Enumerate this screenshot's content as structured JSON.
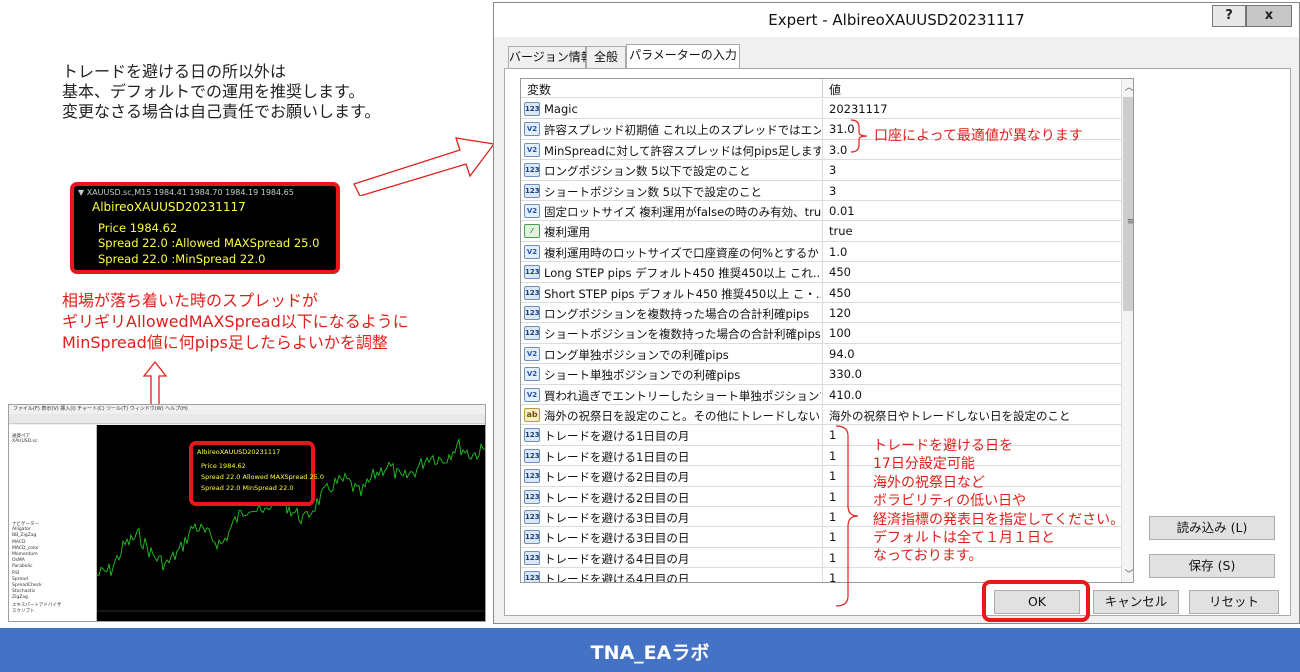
{
  "left_note": {
    "line1": "トレードを避ける日の所以外は",
    "line2": "基本、デフォルトでの運用を推奨します。",
    "line3": "変更なさる場合は自己責任でお願いします。"
  },
  "chart_info": {
    "header": "▼ XAUUSD.sc,M15  1984.41 1984.70 1984.19 1984.65",
    "name": "AlbireoXAUUSD20231117",
    "price": "Price  1984.62",
    "spread_allowed": "Spread  22.0  :Allowed MAXSpread  25.0",
    "spread_min": "Spread  22.0  :MinSpread  22.0"
  },
  "red_note": {
    "line1": "相場が落ち着いた時のスプレッドが",
    "line2": "ギリギリAllowedMAXSpread以下になるように",
    "line3": "MinSpread値に何pips足したらよいかを調整"
  },
  "mini_mt4": {
    "menu": "ファイル(F)  表示(V)  挿入(I)  チャート(C)  ツール(T)  ウィンドウ(W)  ヘルプ(H)",
    "left_items": [
      "通貨ペア",
      "XAUUSD.sc",
      "",
      "",
      "",
      "",
      "",
      "ナビゲーター",
      "Alligator",
      "BB_ZigZag",
      "MACD",
      "MACD_color",
      "Momentum",
      "OsMA",
      "Parabolic",
      "RSI",
      "Spread",
      "SpreadCheck",
      "Stochastic",
      "ZigZag",
      "エキスパートアドバイザ",
      "スクリプト"
    ],
    "info_name": "AlbireoXAUUSD20231117",
    "info_price": "Price  1984.62",
    "info_spread_allowed": "Spread  22.0  Allowed MAXSpread  25.0",
    "info_spread_min": "Spread  22.0  MinSpread  22.0"
  },
  "dialog": {
    "title": "Expert - AlbireoXAUUSD20231117",
    "help": "?",
    "close": "x",
    "tabs": [
      "バージョン情報",
      "全般",
      "パラメーターの入力"
    ],
    "col_variable": "変数",
    "col_value": "値",
    "params": [
      {
        "icon": "123",
        "name": "Magic",
        "value": "20231117"
      },
      {
        "icon": "V2",
        "name": "許容スプレッド初期値  これ以上のスプレッドではエント・..",
        "value": "31.0"
      },
      {
        "icon": "V2",
        "name": "MinSpreadに対して許容スプレッドは何pips足しますか",
        "value": "3.0"
      },
      {
        "icon": "123",
        "name": "ロングポジション数  5以下で設定のこと",
        "value": "3"
      },
      {
        "icon": "123",
        "name": "ショートポジション数  5以下で設定のこと",
        "value": "3"
      },
      {
        "icon": "V2",
        "name": "固定ロットサイズ 複利運用がfalseの時のみ有効、tru...",
        "value": "0.01"
      },
      {
        "icon": "bool",
        "name": "複利運用",
        "value": "true"
      },
      {
        "icon": "V2",
        "name": "複利運用時のロットサイズで口座資産の何%とするか・..",
        "value": "1.0"
      },
      {
        "icon": "123",
        "name": "Long STEP pips デフォルト450 推奨450以上 これ...",
        "value": "450"
      },
      {
        "icon": "123",
        "name": "Short STEP pips デフォルト450 推奨450以上 こ・..",
        "value": "450"
      },
      {
        "icon": "123",
        "name": "ロングポジションを複数持った場合の合計利確pips",
        "value": "120"
      },
      {
        "icon": "123",
        "name": "ショートポジションを複数持った場合の合計利確pips",
        "value": "100"
      },
      {
        "icon": "V2",
        "name": "ロング単独ポジションでの利確pips",
        "value": "94.0"
      },
      {
        "icon": "V2",
        "name": "ショート単独ポジションでの利確pips",
        "value": "330.0"
      },
      {
        "icon": "V2",
        "name": "買われ過ぎでエントリーしたショート単独ポジションでの・..",
        "value": "410.0"
      },
      {
        "icon": "ab",
        "name": "海外の祝祭日を設定のこと。その他にトレードしない日・..",
        "value": "海外の祝祭日やトレードしない日を設定のこと"
      },
      {
        "icon": "123",
        "name": "トレードを避ける1日目の月",
        "value": "1"
      },
      {
        "icon": "123",
        "name": "トレードを避ける1日目の日",
        "value": "1"
      },
      {
        "icon": "123",
        "name": "トレードを避ける2日目の月",
        "value": "1"
      },
      {
        "icon": "123",
        "name": "トレードを避ける2日目の日",
        "value": "1"
      },
      {
        "icon": "123",
        "name": "トレードを避ける3日目の月",
        "value": "1"
      },
      {
        "icon": "123",
        "name": "トレードを避ける3日目の日",
        "value": "1"
      },
      {
        "icon": "123",
        "name": "トレードを避ける4日目の月",
        "value": "1"
      },
      {
        "icon": "123",
        "name": "トレードを避ける4日目の日",
        "value": "1"
      }
    ],
    "btn_load": "読み込み (L)",
    "btn_save": "保存 (S)",
    "btn_ok": "OK",
    "btn_cancel": "キャンセル",
    "btn_reset": "リセット"
  },
  "annotations": {
    "spread_note": "口座によって最適値が異なります",
    "avoid_days": [
      "トレードを避ける日を",
      "17日分設定可能",
      "海外の祝祭日など",
      "ボラビリティの低い日や",
      "経済指標の発表日を指定してください。",
      "デフォルトは全て１月１日と",
      "なっております。"
    ]
  },
  "footer": {
    "text": "TNA_EAラボ"
  },
  "colors": {
    "accent_red": "#e8171a",
    "footer_blue": "#4472c4",
    "info_yellow": "#ffff40"
  }
}
